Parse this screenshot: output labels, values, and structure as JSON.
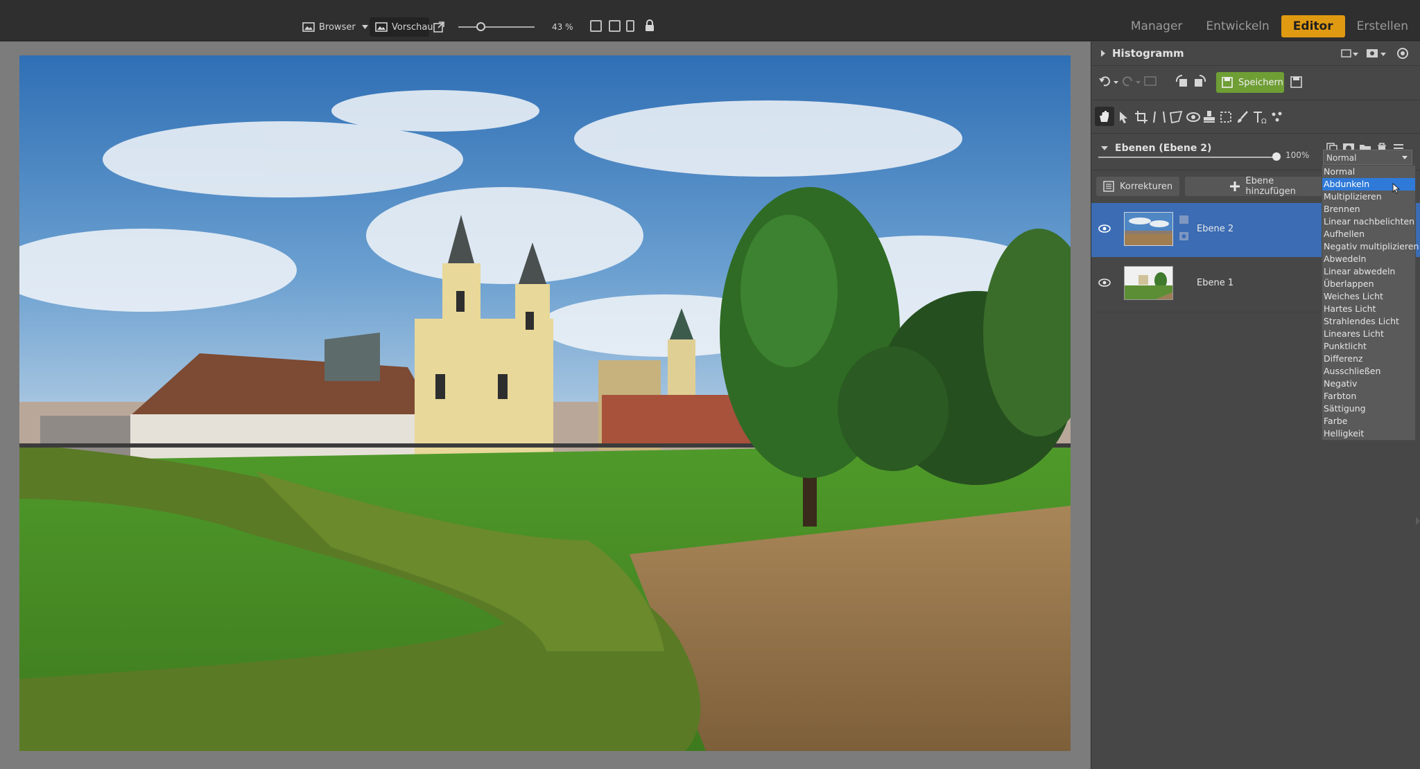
{
  "topbar": {
    "browser_label": "Browser",
    "preview_label": "Vorschau",
    "zoom": "43 %",
    "modes": [
      "Manager",
      "Entwickeln",
      "Editor",
      "Erstellen"
    ],
    "active_mode": "Editor"
  },
  "panel": {
    "histogram_title": "Histogramm",
    "save_label": "Speichern",
    "layers_title": "Ebenen (Ebene 2)",
    "opacity": "100%",
    "blend_mode": "Normal",
    "corrections_label": "Korrekturen",
    "add_layer_label": "Ebene hinzufügen",
    "layers": [
      {
        "name": "Ebene 2",
        "selected": true
      },
      {
        "name": "Ebene 1",
        "selected": false
      }
    ]
  },
  "blend_dropdown": {
    "highlighted": "Abdunkeln",
    "options": [
      "Normal",
      "Abdunkeln",
      "Multiplizieren",
      "Brennen",
      "Linear nachbelichten",
      "Aufhellen",
      "Negativ multiplizieren",
      "Abwedeln",
      "Linear abwedeln",
      "Überlappen",
      "Weiches Licht",
      "Hartes Licht",
      "Strahlendes Licht",
      "Lineares Licht",
      "Punktlicht",
      "Differenz",
      "Ausschließen",
      "Negativ",
      "Farbton",
      "Sättigung",
      "Farbe",
      "Helligkeit"
    ]
  },
  "colors": {
    "accent": "#e09a12",
    "save_green": "#6f9e35",
    "selection_blue": "#3b6cb4",
    "dropdown_highlight": "#2f7ad9"
  }
}
